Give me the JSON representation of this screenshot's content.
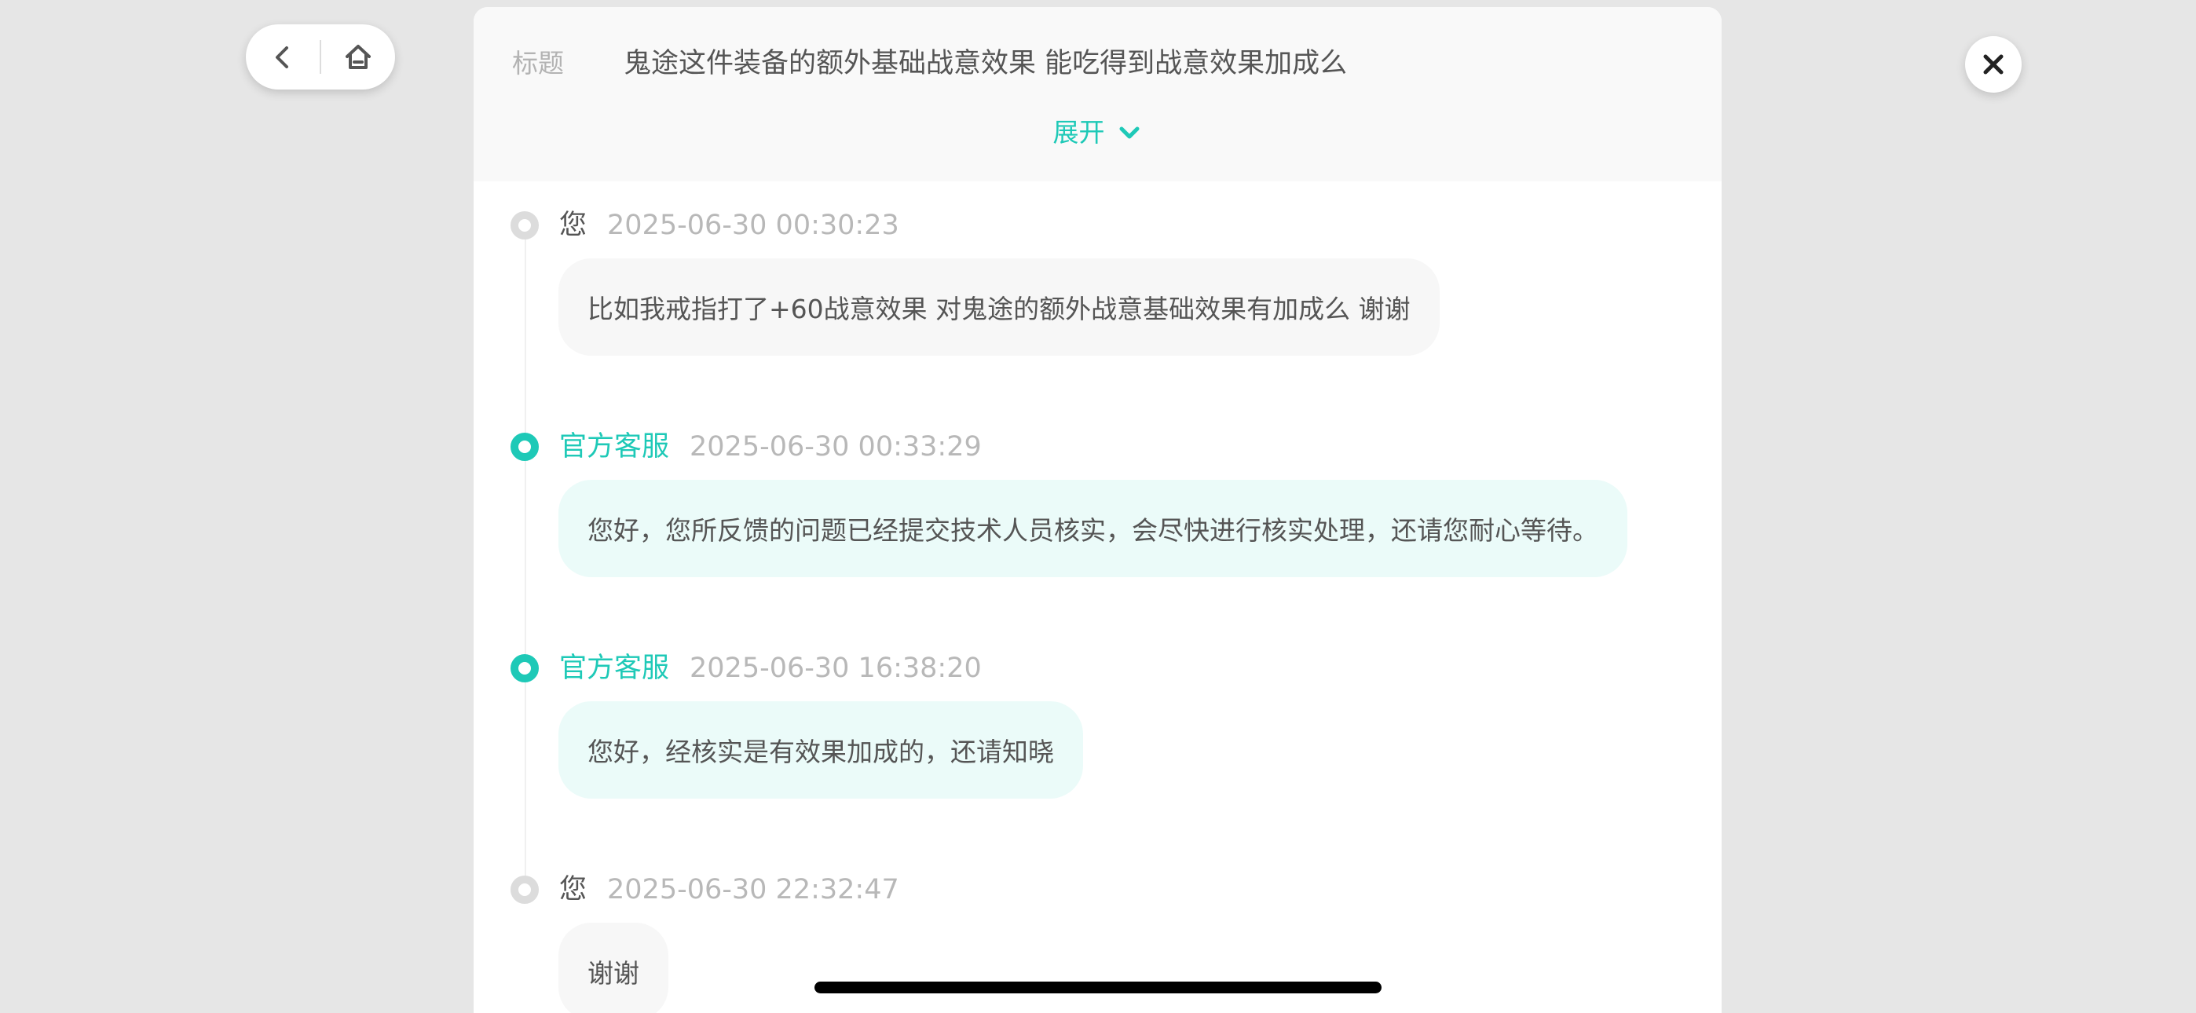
{
  "nav": {
    "back_icon": "chevron-left-icon",
    "home_icon": "home-icon"
  },
  "close_icon": "close-icon",
  "header": {
    "title_label": "标题",
    "title": "鬼途这件装备的额外基础战意效果 能吃得到战意效果加成么",
    "expand_label": "展开",
    "expand_icon": "chevron-down-icon"
  },
  "colors": {
    "accent": "#1ec9b7",
    "user_dot": "#dcdcdc",
    "staff_bubble": "#ebfbf9",
    "user_bubble": "#f7f7f7",
    "background": "#e6e6e6"
  },
  "messages": [
    {
      "author": "您",
      "role": "user",
      "time": "2025-06-30 00:30:23",
      "text": "比如我戒指打了+60战意效果 对鬼途的额外战意基础效果有加成么 谢谢"
    },
    {
      "author": "官方客服",
      "role": "staff",
      "time": "2025-06-30 00:33:29",
      "text": "您好，您所反馈的问题已经提交技术人员核实，会尽快进行核实处理，还请您耐心等待。"
    },
    {
      "author": "官方客服",
      "role": "staff",
      "time": "2025-06-30 16:38:20",
      "text": "您好，经核实是有效果加成的，还请知晓"
    },
    {
      "author": "您",
      "role": "user",
      "time": "2025-06-30 22:32:47",
      "text": "谢谢"
    }
  ]
}
